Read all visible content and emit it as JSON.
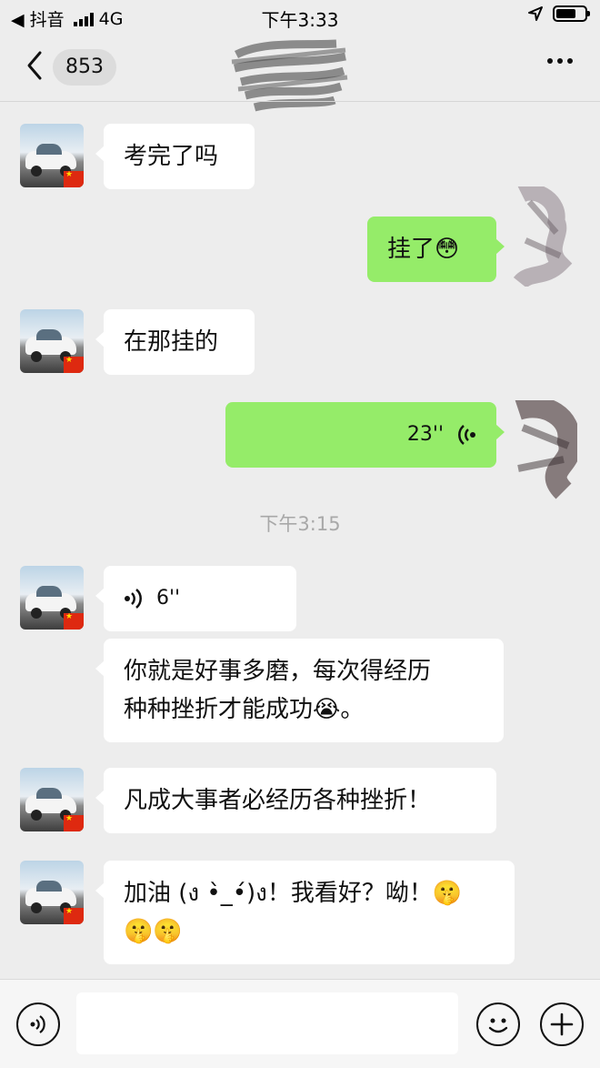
{
  "status_bar": {
    "back_app": "◀ 抖音",
    "network": "4G",
    "time": "下午3:33",
    "battery_level": 0.7
  },
  "header": {
    "unread_count": "853",
    "more_icon": "more-horizontal-icon"
  },
  "messages": [
    {
      "side": "left",
      "text": "考完了吗"
    },
    {
      "side": "right",
      "text": "挂了",
      "emoji": "😳"
    },
    {
      "side": "left",
      "text": "在那挂的"
    },
    {
      "side": "right",
      "type": "voice",
      "duration": "23''"
    },
    {
      "side": "left",
      "type": "voice",
      "duration": "6''"
    },
    {
      "side": "left",
      "text_line1": "你就是好事多磨，每次得经历",
      "text_line2": "种种挫折才能成功",
      "emoji": "😭",
      "suffix": "。"
    },
    {
      "side": "left",
      "text": "凡成大事者必经历各种挫折！"
    },
    {
      "side": "left",
      "text_line1": "加油 (ง •̀_•́)ง！我看好？呦！",
      "emoji": "🤫",
      "emoji2": "🤫🤫"
    }
  ],
  "timestamp": "下午3:15",
  "input_bar": {
    "voice_icon": "voice-input-icon",
    "emoji_icon": "emoji-icon",
    "plus_icon": "plus-icon",
    "input_value": ""
  },
  "colors": {
    "background": "#ededed",
    "my_bubble": "#95ec69",
    "their_bubble": "#ffffff",
    "timestamp_text": "#a8a8a8"
  }
}
